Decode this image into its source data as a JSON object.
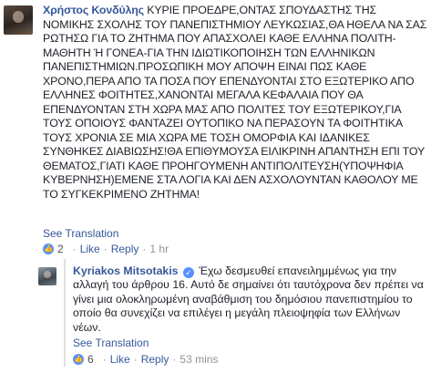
{
  "comment1": {
    "author": "Χρήστος Κονδύλης",
    "text": "ΚΥΡΙΕ ΠΡΟΕΔΡΕ,ΟΝΤΑΣ ΣΠΟΥΔΑΣΤΗΣ ΤΗΣ ΝΟΜΙΚΗΣ ΣΧΟΛΗΣ ΤΟΥ ΠΑΝΕΠΙΣΤΗΜΙΟΥ ΛΕΥΚΩΣΙΑΣ,ΘΑ ΗΘΕΛΑ ΝΑ ΣΑΣ ΡΩΤΗΣΩ ΓΙΑ ΤΟ ΖΗΤΗΜΑ ΠΟΥ ΑΠΑΣΧΟΛΕΙ ΚΑΘΕ ΕΛΛΗΝΑ ΠΟΛΙΤΗ-ΜΑΘΗΤΗ Ή ΓΟΝΕΑ-ΓΙΑ ΤΗΝ ΙΔΙΩΤΙΚΟΠΟΙΗΣΗ ΤΩΝ ΕΛΛΗΝΙΚΩΝ ΠΑΝΕΠΙΣΤΗΜΙΩΝ.ΠΡΟΣΩΠΙΚΗ ΜΟΥ ΑΠΟΨΗ ΕΙΝΑΙ ΠΩΣ ΚΑΘΕ ΧΡΟΝΟ,ΠΕΡΑ ΑΠΟ ΤΑ ΠΟΣΑ ΠΟΥ ΕΠΕΝΔΥΟΝΤΑΙ ΣΤΟ ΕΞΩΤΕΡΙΚΟ ΑΠΟ ΕΛΛΗΝΕΣ ΦΟΙΤΗΤΕΣ,ΧΑΝΟΝΤΑΙ ΜΕΓΑΛΑ ΚΕΦΑΛΑΙΑ ΠΟΥ ΘΑ ΕΠΕΝΔΥΟΝΤΑΝ ΣΤΗ ΧΩΡΑ ΜΑΣ ΑΠΟ ΠΟΛΙΤΕΣ ΤΟΥ ΕΞΩΤΕΡΙΚΟΥ,ΓΙΑ ΤΟΥΣ ΟΠΟΙΟΥΣ ΦΑΝΤΑΖΕΙ ΟΥΤΟΠΙΚΟ ΝΑ ΠΕΡΑΣΟΥΝ ΤΑ ΦΟΙΤΗΤΙΚΑ ΤΟΥΣ ΧΡΟΝΙΑ ΣΕ ΜΙΑ ΧΩΡΑ ΜΕ ΤΟΣΗ ΟΜΟΡΦΙΑ ΚΑΙ ΙΔΑΝΙΚΕΣ ΣΥΝΘΗΚΕΣ ΔΙΑΒΙΩΣΗΣ!ΘΑ ΕΠΙΘΥΜΟΥΣΑ ΕΙΛΙΚΡΙΝΗ ΑΠΑΝΤΗΣΗ ΕΠΙ ΤΟΥ ΘΕΜΑΤΟΣ,ΓΙΑΤΙ ΚΑΘΕ ΠΡΟΗΓΟΥΜΕΝΗ ΑΝΤΙΠΟΛΙΤΕΥΣΗ(ΥΠΟΨΗΦΙΑ ΚΥΒΕΡΝΗΣΗ)ΕΜΕΝΕ ΣΤΑ ΛΟΓΙΑ ΚΑΙ ΔΕΝ ΑΣΧΟΛΟΥΝΤΑΝ ΚΑΘΟΛΟΥ ΜΕ ΤΟ ΣΥΓΚΕΚΡΙΜΕΝΟ ΖΗΤΗΜΑ!",
    "see_translation": "See Translation",
    "like_count": "2",
    "like": "Like",
    "reply": "Reply",
    "time": "1 hr"
  },
  "comment2": {
    "author": "Kyriakos Mitsotakis",
    "text": "Έχω δεσμευθεί επανειλημμένως για την αλλαγή του άρθρου 16. Αυτό δε σημαίνει ότι ταυτόχρονα δεν πρέπει να γίνει μια ολοκληρωμένη αναβάθμιση του δημόσιου πανεπιστημίου το οποίο θα συνεχίζει να επιλέγει η μεγάλη πλειοψηφία των Ελλήνων νέων.",
    "see_translation": "See Translation",
    "like_count": "6",
    "like": "Like",
    "reply": "Reply",
    "time": "53 mins"
  },
  "icons": {
    "verified": "verified-badge-icon",
    "like": "thumbs-up-icon"
  },
  "colors": {
    "link": "#365899",
    "meta": "#90949c",
    "like_blue": "#5890ff"
  }
}
